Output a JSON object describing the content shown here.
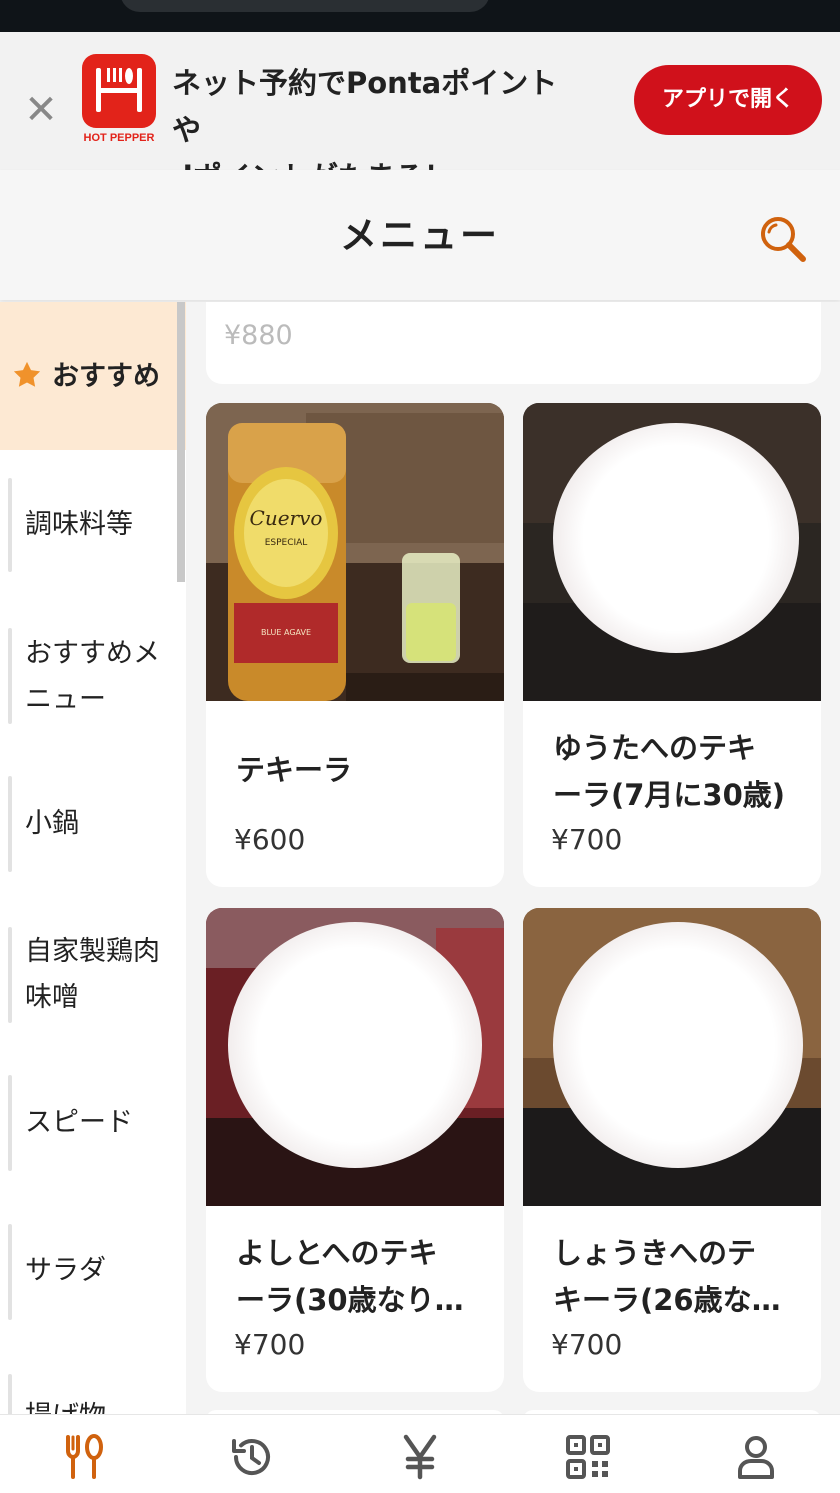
{
  "banner": {
    "logo_text": "HOT PEPPER",
    "text_line1": "ネット予約でPontaポイント",
    "text_line2": "や",
    "text_line3": "dポイントがたまる！",
    "open_button": "アプリで開く"
  },
  "header": {
    "title": "メニュー"
  },
  "sidebar": {
    "active": "おすすめ",
    "items": [
      {
        "label_line1": "調味料等",
        "label_line2": ""
      },
      {
        "label_line1": "おすすめメ",
        "label_line2": "ニュー"
      },
      {
        "label_line1": "小鍋",
        "label_line2": ""
      },
      {
        "label_line1": "自家製鶏肉",
        "label_line2": "味噌"
      },
      {
        "label_line1": "スピード",
        "label_line2": ""
      },
      {
        "label_line1": "サラダ",
        "label_line2": ""
      },
      {
        "label_line1": "揚げ物",
        "label_line2": ""
      }
    ]
  },
  "menu": {
    "top_partial_price": "¥880",
    "cards": [
      {
        "name_line1": "テキーラ",
        "name_line2": "",
        "price": "¥600"
      },
      {
        "name_line1": "ゆうたへのテキ",
        "name_line2": "ーラ(7月に30歳)",
        "price": "¥700"
      },
      {
        "name_line1": "よしとへのテキ",
        "name_line2": "ーラ(30歳なり…",
        "price": "¥700"
      },
      {
        "name_line1": "しょうきへのテ",
        "name_line2": "キーラ(26歳な…",
        "price": "¥700"
      }
    ]
  },
  "colors": {
    "brand_red": "#d0111b",
    "accent_orange": "#d0620e",
    "active_bg": "#fde9d3"
  },
  "icons": {
    "close": "close-icon",
    "search": "search-icon",
    "star": "star-icon",
    "nav": [
      "fork-spoon-icon",
      "history-icon",
      "yen-icon",
      "qr-code-icon",
      "user-icon"
    ]
  }
}
